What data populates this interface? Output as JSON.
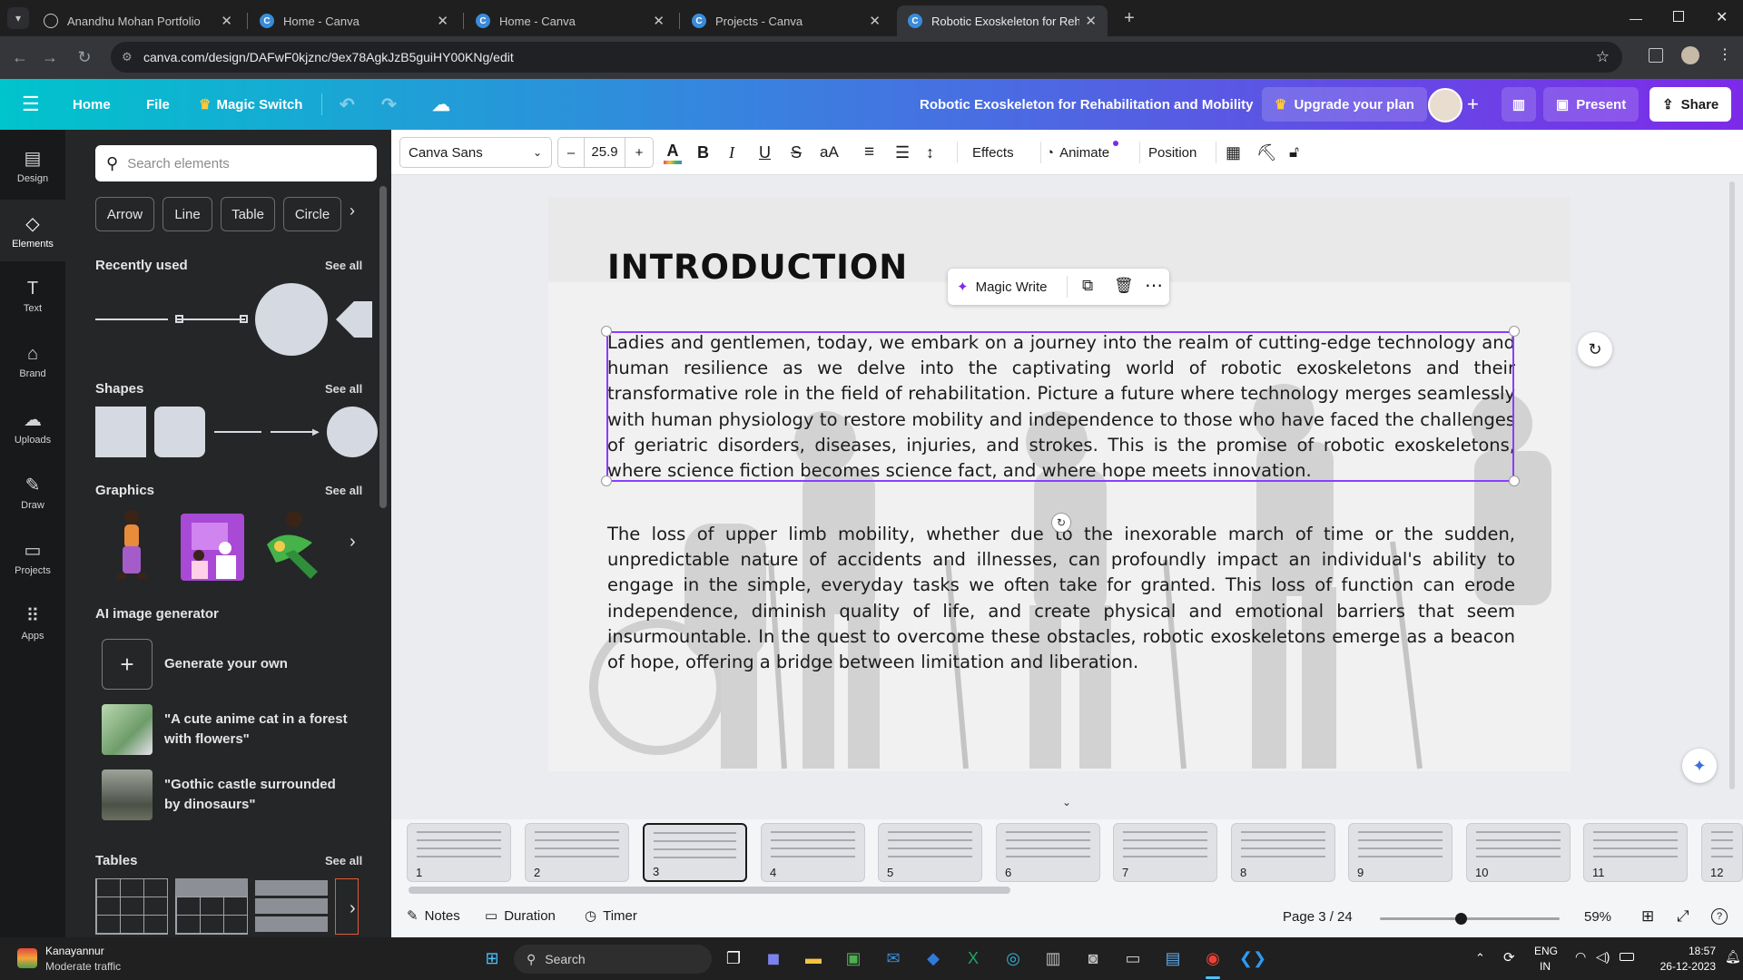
{
  "browser": {
    "tabs": [
      {
        "label": "Anandhu Mohan Portfolio",
        "icon": "globe-icon"
      },
      {
        "label": "Home - Canva",
        "icon": "canva-icon"
      },
      {
        "label": "Home - Canva",
        "icon": "canva-icon"
      },
      {
        "label": "Projects - Canva",
        "icon": "canva-icon"
      },
      {
        "label": "Robotic Exoskeleton for Rehabil",
        "icon": "canva-icon"
      }
    ],
    "url": "canva.com/design/DAFwF0kjznc/9ex78AgkJzB5guiHY00KNg/edit"
  },
  "header": {
    "home": "Home",
    "file": "File",
    "magic_switch": "Magic Switch",
    "doc_title": "Robotic Exoskeleton for Rehabilitation and Mobility",
    "upgrade": "Upgrade your plan",
    "present": "Present",
    "share": "Share"
  },
  "rail": [
    {
      "label": "Design",
      "icon": "layout-icon"
    },
    {
      "label": "Elements",
      "icon": "shapes-icon"
    },
    {
      "label": "Text",
      "icon": "text-icon"
    },
    {
      "label": "Brand",
      "icon": "brand-icon"
    },
    {
      "label": "Uploads",
      "icon": "cloud-upload-icon"
    },
    {
      "label": "Draw",
      "icon": "pen-icon"
    },
    {
      "label": "Projects",
      "icon": "folder-icon"
    },
    {
      "label": "Apps",
      "icon": "grid-icon"
    }
  ],
  "panel": {
    "search_placeholder": "Search elements",
    "chips": [
      "Arrow",
      "Line",
      "Table",
      "Circle"
    ],
    "recently_used": "Recently used",
    "shapes": "Shapes",
    "graphics": "Graphics",
    "ai_generator": "AI image generator",
    "generate_own": "Generate your own",
    "prompt1": "\"A cute anime cat in a forest with flowers\"",
    "prompt2": "\"Gothic castle surrounded by dinosaurs\"",
    "tables": "Tables",
    "see_all": "See all"
  },
  "toolbar": {
    "font": "Canva Sans",
    "font_size": "25.9",
    "effects": "Effects",
    "animate": "Animate",
    "position": "Position"
  },
  "slide": {
    "title": "INTRODUCTION",
    "magic_write": "Magic Write",
    "para1": "Ladies and gentlemen, today, we embark on a journey into the realm of cutting-edge technology and human resilience as we delve into the captivating world of robotic exoskeletons and their transformative role in the field of rehabilitation. Picture a future where technology merges seamlessly with human physiology to restore mobility and independence to those who have faced the challenges of geriatric disorders, diseases, injuries, and strokes. This is the promise of robotic exoskeletons, where science fiction becomes science fact, and where hope meets innovation.",
    "para2": "The loss of upper limb mobility, whether due to the inexorable march of time or the sudden, unpredictable nature of accidents and illnesses, can profoundly impact an individual's ability to engage in the simple, everyday tasks we often take for granted. This loss of function can erode independence, diminish quality of life, and create physical and emotional barriers that seem insurmountable. In the quest to overcome these obstacles, robotic exoskeletons emerge as a beacon of hope, offering a bridge between limitation and liberation."
  },
  "thumbnails": [
    "1",
    "2",
    "3",
    "4",
    "5",
    "6",
    "7",
    "8",
    "9",
    "10",
    "11",
    "12"
  ],
  "footer": {
    "notes": "Notes",
    "duration": "Duration",
    "timer": "Timer",
    "page": "Page 3 / 24",
    "zoom": "59%",
    "zoom_level": 0.45
  },
  "taskbar": {
    "weather_title": "Kanayannur",
    "weather_sub": "Moderate traffic",
    "search": "Search",
    "lang1": "ENG",
    "lang2": "IN",
    "time": "18:57",
    "date": "26-12-2023"
  },
  "colors": {
    "accent": "#7d2ae8",
    "teal": "#00c4cc",
    "selection": "#8b3dff"
  }
}
